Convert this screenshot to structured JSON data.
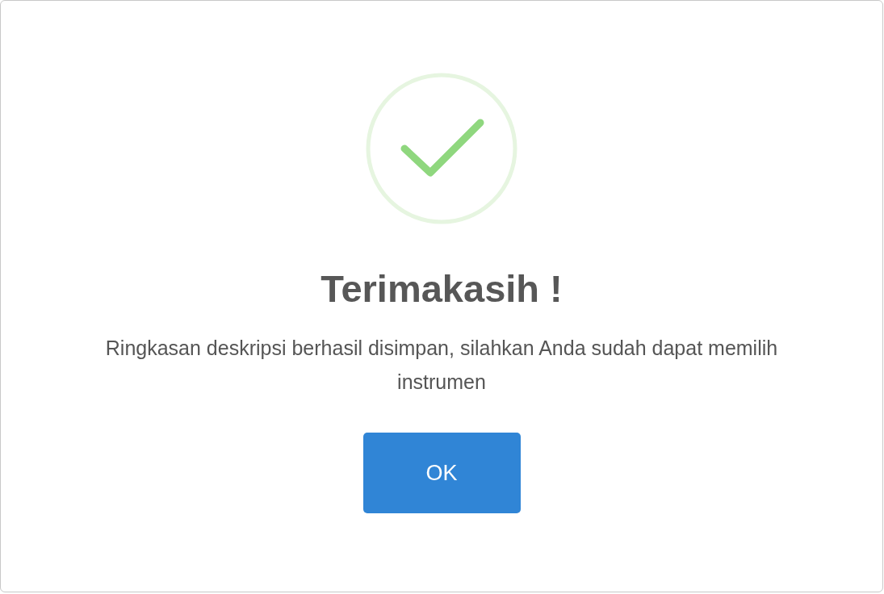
{
  "dialog": {
    "icon": {
      "kind": "success"
    },
    "title": "Terimakasih !",
    "message": "Ringkasan deskripsi berhasil disimpan, silahkan Anda sudah dapat memilih instrumen",
    "buttons": [
      {
        "label": "OK"
      }
    ]
  }
}
